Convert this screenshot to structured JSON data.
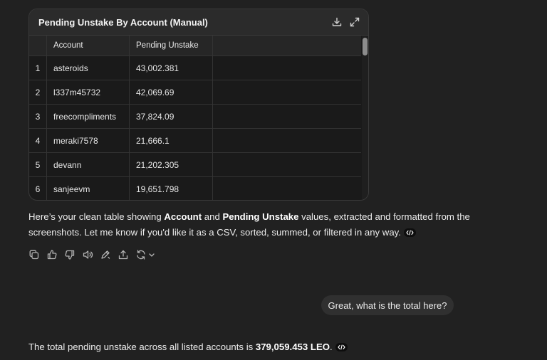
{
  "table_card": {
    "title": "Pending Unstake By Account (Manual)",
    "download_icon": "download-icon",
    "expand_icon": "expand-icon",
    "columns": [
      "",
      "Account",
      "Pending Unstake"
    ],
    "rows": [
      {
        "idx": "1",
        "account": "asteroids",
        "pending": "43,002.381"
      },
      {
        "idx": "2",
        "account": "l337m45732",
        "pending": "42,069.69"
      },
      {
        "idx": "3",
        "account": "freecompliments",
        "pending": "37,824.09"
      },
      {
        "idx": "4",
        "account": "meraki7578",
        "pending": "21,666.1"
      },
      {
        "idx": "5",
        "account": "devann",
        "pending": "21,202.305"
      },
      {
        "idx": "6",
        "account": "sanjeevm",
        "pending": "19,651.798"
      }
    ]
  },
  "assistant_message_1": {
    "t1": "Here’s your clean table showing ",
    "b1": "Account",
    "t2": " and ",
    "b2": "Pending Unstake",
    "t3": " values, extracted and formatted from the screenshots. Let me know if you'd like it as a CSV, sorted, summed, or filtered in any way.",
    "code_icon": "code-icon"
  },
  "action_bar": {
    "icons": [
      "copy-icon",
      "thumbs-up-icon",
      "thumbs-down-icon",
      "read-aloud-icon",
      "edit-icon",
      "share-icon",
      "regenerate-icon",
      "chevron-down-icon"
    ]
  },
  "user_message": {
    "text": "Great, what is the total here?"
  },
  "assistant_message_2": {
    "t1": "The total pending unstake across all listed accounts is ",
    "b1": "379,059.453 LEO",
    "t2": ".",
    "code_icon": "code-icon"
  },
  "colors": {
    "background": "#212121",
    "card": "#1a1a1a",
    "card_header": "#2b2b2b",
    "bubble": "#303030",
    "text": "#ececec"
  }
}
